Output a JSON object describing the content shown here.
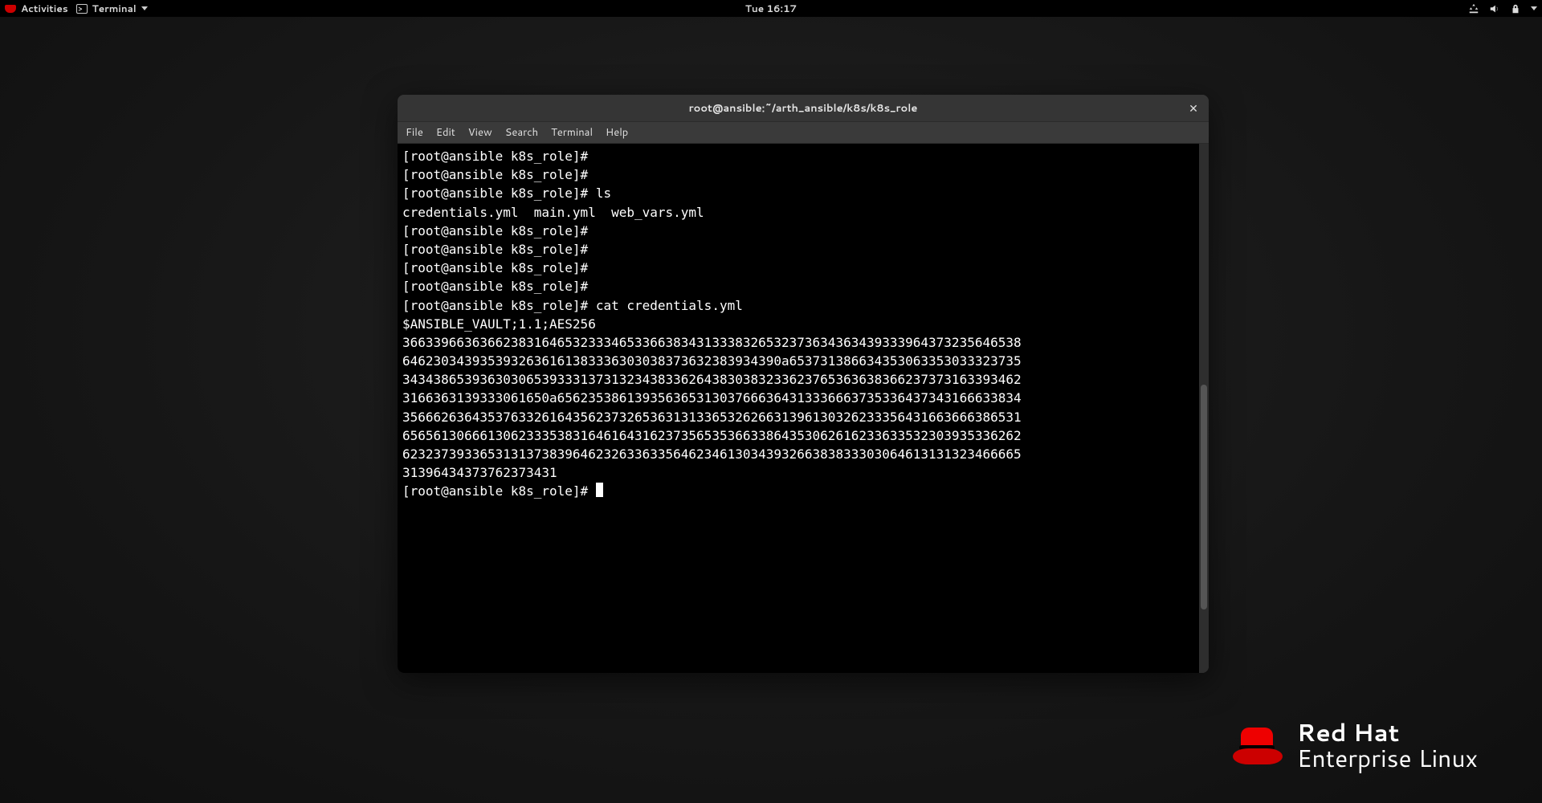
{
  "topbar": {
    "activities": "Activities",
    "app_name": "Terminal",
    "clock": "Tue 16:17"
  },
  "window": {
    "title": "root@ansible:~/arth_ansible/k8s/k8s_role",
    "menu": {
      "file": "File",
      "edit": "Edit",
      "view": "View",
      "search": "Search",
      "terminal": "Terminal",
      "help": "Help"
    }
  },
  "terminal": {
    "prompt": "[root@ansible k8s_role]#",
    "cmd_ls": "ls",
    "ls_output": "credentials.yml  main.yml  web_vars.yml",
    "cmd_cat": "cat credentials.yml",
    "vault_header": "$ANSIBLE_VAULT;1.1;AES256",
    "vault_lines": [
      "36633966363662383164653233346533663834313338326532373634363439333964373235646538",
      "6462303439353932636161383336303038373632383934390a653731386634353063353033323735",
      "34343865393630306539333137313234383362643830383233623765363638366237373163393462",
      "3166363139333061650a656235386139356365313037666364313336663735336437343166633834",
      "35666263643537633261643562373265363131336532626631396130326233356431663666386531",
      "65656130666130623335383164616431623735653536633864353062616233633532303935336262",
      "62323739336531313738396462326336335646234613034393266383833303064613131323466665",
      "31396434373762373431"
    ]
  },
  "branding": {
    "line1": "Red Hat",
    "line2": "Enterprise Linux"
  }
}
